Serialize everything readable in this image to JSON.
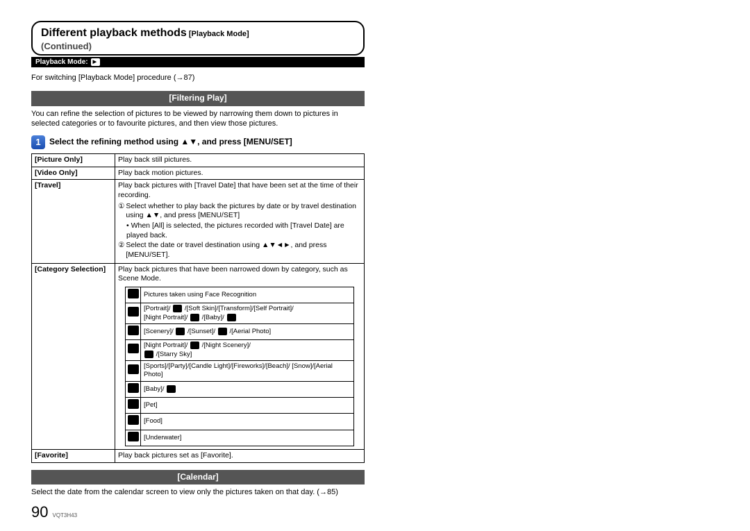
{
  "title": {
    "main": "Different playback methods",
    "mode": "[Playback Mode]",
    "continued": "(Continued)",
    "mode_bar_label": "Playback Mode:"
  },
  "intro": "For switching [Playback Mode] procedure (→87)",
  "filtering": {
    "header": "[Filtering Play]",
    "note": "You can refine the selection of pictures to be viewed by narrowing them down to pictures in selected categories or to favourite pictures, and then view those pictures.",
    "step_num": "1",
    "step_text": "Select the refining method using ▲▼, and press [MENU/SET]"
  },
  "rows": {
    "picture_only": {
      "label": "[Picture Only]",
      "desc": "Play back still pictures."
    },
    "video_only": {
      "label": "[Video Only]",
      "desc": "Play back motion pictures."
    },
    "travel": {
      "label": "[Travel]",
      "desc": "Play back pictures with [Travel Date] that have been set at the time of their recording.",
      "sub1": "Select whether to play back the pictures by date or by travel destination using ▲▼, and press [MENU/SET]",
      "sub1_bullet": "• When [All] is selected, the pictures recorded with [Travel Date] are played back.",
      "sub2": "Select the date or travel destination using ▲▼◄►, and press [MENU/SET]."
    },
    "category": {
      "label": "[Category Selection]",
      "desc": "Play back pictures that have been narrowed down by category, such as Scene Mode."
    },
    "favorite": {
      "label": "[Favorite]",
      "desc": "Play back pictures set as [Favorite]."
    }
  },
  "categories": {
    "r0": "Pictures taken using Face Recognition",
    "r1a": "[Portrait]/ ",
    "r1b": " /[Soft Skin]/[Transform]/[Self Portrait]/",
    "r1c": "[Night Portrait]/ ",
    "r1d": " /[Baby]/ ",
    "r2a": "[Scenery]/ ",
    "r2b": " /[Sunset]/ ",
    "r2c": " /[Aerial Photo]",
    "r3a": "[Night Portrait]/ ",
    "r3b": " /[Night Scenery]/",
    "r3c": " /[Starry Sky]",
    "r4": "[Sports]/[Party]/[Candle Light]/[Fireworks]/[Beach]/ [Snow]/[Aerial Photo]",
    "r5a": "[Baby]/ ",
    "r6": "[Pet]",
    "r7": "[Food]",
    "r8": "[Underwater]"
  },
  "calendar": {
    "header": "[Calendar]",
    "note": "Select the date from the calendar screen to view only the pictures taken on that day. (→85)"
  },
  "footer": {
    "page": "90",
    "code": "VQT3H43"
  }
}
